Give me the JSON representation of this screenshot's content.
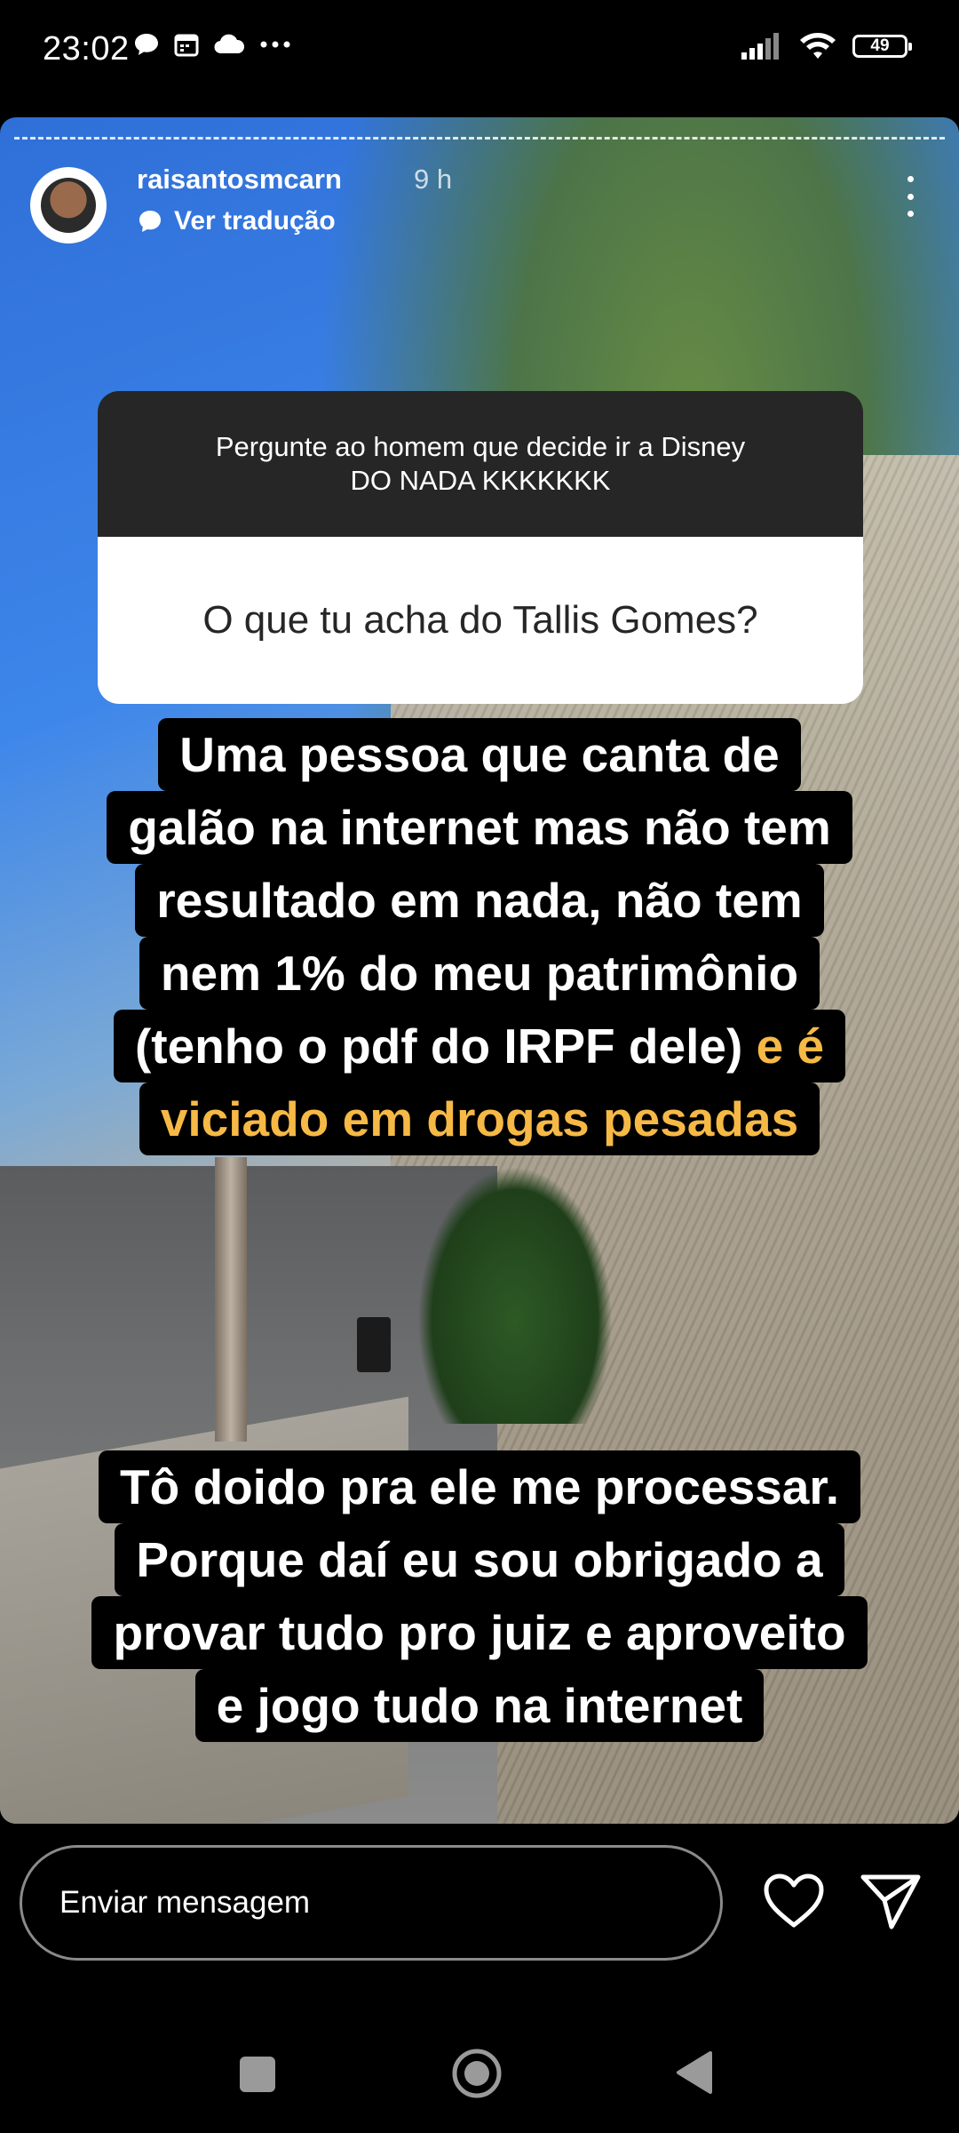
{
  "status_bar": {
    "time": "23:02",
    "left_icons": [
      "chat-bubble-icon",
      "calendar-icon",
      "cloud-icon",
      "more-dots-icon"
    ],
    "right_icons": [
      "signal-icon",
      "wifi-icon",
      "battery-icon"
    ],
    "battery_level": "49"
  },
  "story": {
    "username": "raisantosmcarn",
    "timestamp": "9 h",
    "translate_label": "Ver tradução",
    "question": {
      "header_line1": "Pergunte ao homem que decide ir a Disney",
      "header_line2": "DO NADA KKKKKKK",
      "answer": "O que tu acha do Tallis Gomes?"
    },
    "caption1": {
      "line1": "Uma pessoa que canta de",
      "line2": "galão na internet mas não tem",
      "line3": "resultado em nada, não tem",
      "line4": "nem 1% do meu patrimônio",
      "line5_white": "(tenho o pdf do IRPF dele)",
      "line5_yellow": "e é",
      "line6_yellow": "viciado em drogas pesadas"
    },
    "caption2": {
      "line1": "Tô doido pra ele me processar.",
      "line2": "Porque daí eu sou obrigado a",
      "line3": "provar tudo pro juiz e aproveito",
      "line4": "e jogo tudo na internet"
    },
    "highlight_color": "#f6b946"
  },
  "bottom_bar": {
    "message_placeholder": "Enviar mensagem",
    "like_icon": "heart-icon",
    "send_icon": "send-icon"
  },
  "nav_bar": {
    "icons": [
      "recent-apps-icon",
      "home-icon",
      "back-icon"
    ]
  }
}
